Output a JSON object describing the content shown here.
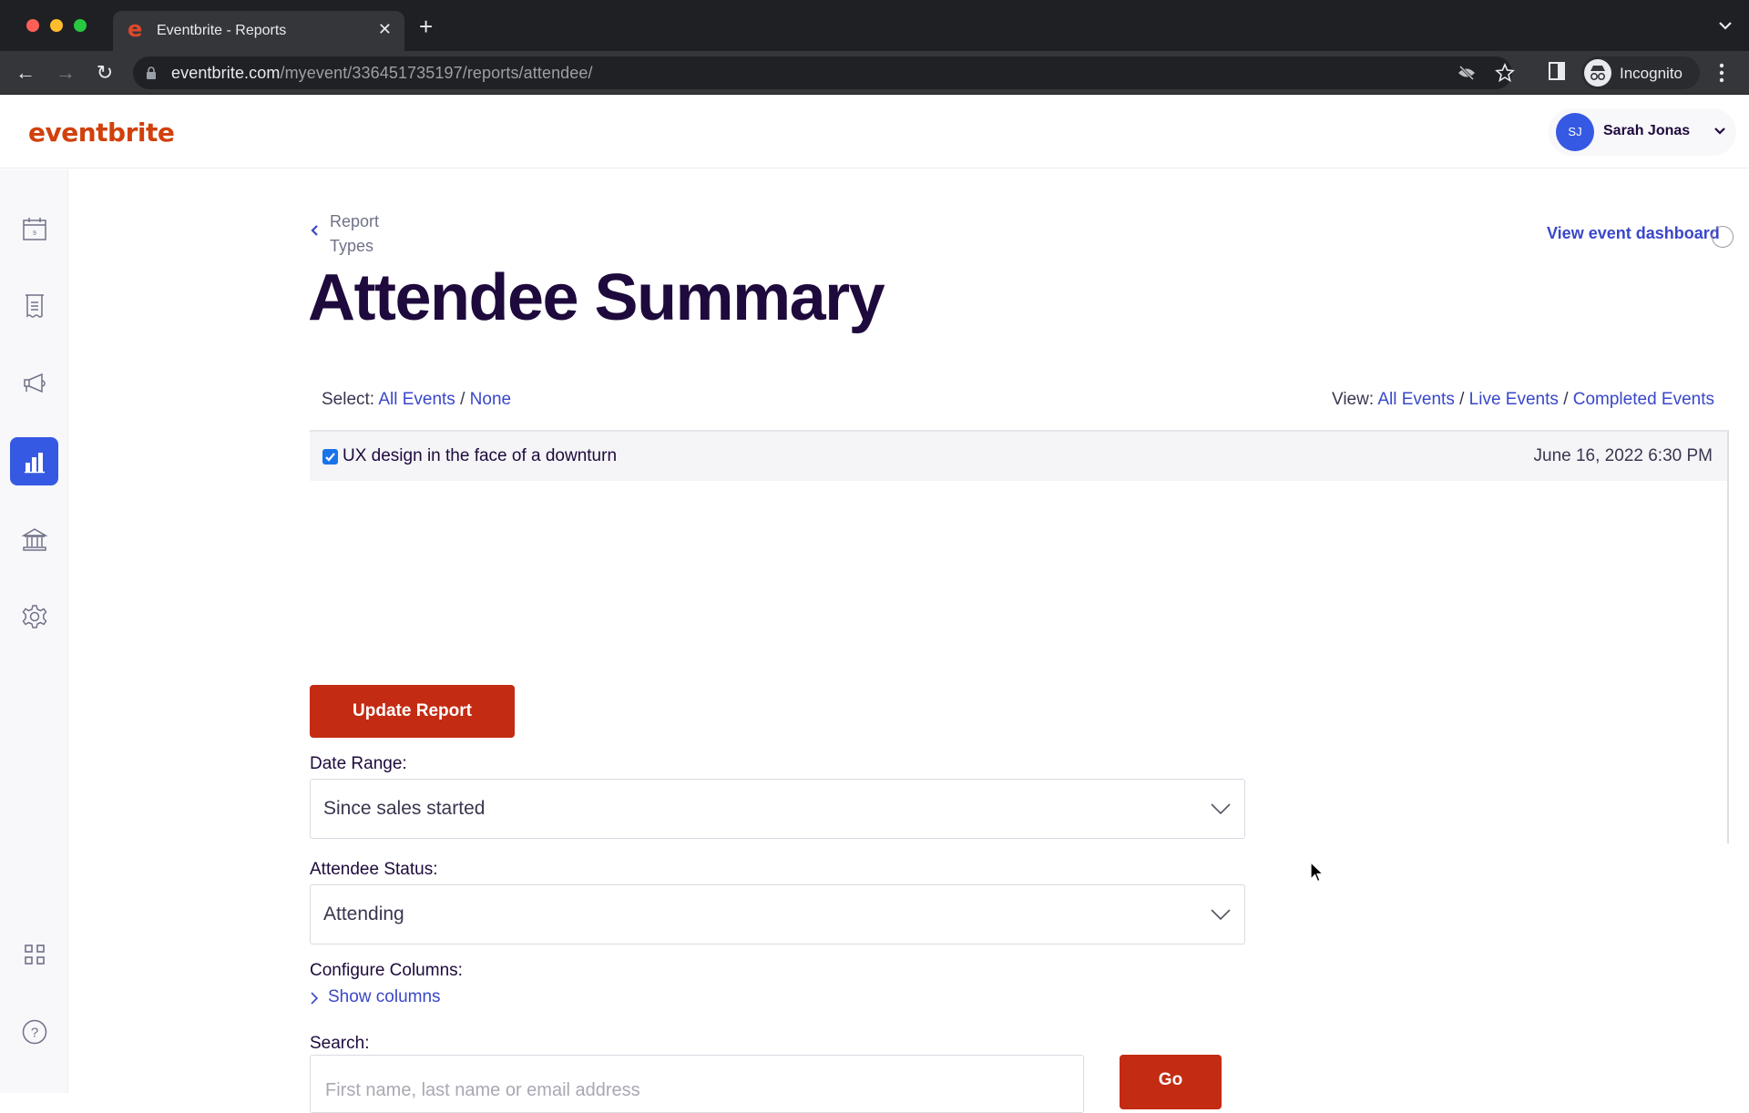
{
  "browser": {
    "tab_title": "Eventbrite - Reports",
    "url_domain": "eventbrite.com",
    "url_path": "/myevent/336451735197/reports/attendee/",
    "profile_label": "Incognito"
  },
  "header": {
    "logo": "eventbrite",
    "user_initials": "SJ",
    "user_name": "Sarah Jonas"
  },
  "sidebar": {
    "items": [
      {
        "name": "events",
        "icon": "calendar-icon",
        "active": false
      },
      {
        "name": "orders",
        "icon": "receipt-icon",
        "active": false
      },
      {
        "name": "marketing",
        "icon": "megaphone-icon",
        "active": false
      },
      {
        "name": "reports",
        "icon": "bar-chart-icon",
        "active": true
      },
      {
        "name": "finance",
        "icon": "bank-icon",
        "active": false
      },
      {
        "name": "settings",
        "icon": "gear-icon",
        "active": false
      },
      {
        "name": "apps",
        "icon": "grid-icon",
        "active": false
      },
      {
        "name": "help",
        "icon": "help-icon",
        "active": false
      }
    ],
    "calendar_day": "9"
  },
  "main": {
    "back_link": "Report Types",
    "title": "Attendee Summary",
    "dashboard_link": "View event dashboard",
    "select": {
      "label": "Select:",
      "all": "All Events",
      "separator": "/",
      "none": "None"
    },
    "view": {
      "label": "View:",
      "all": "All Events",
      "live": "Live Events",
      "completed": "Completed Events",
      "separator": "/"
    },
    "events": [
      {
        "name": "UX design in the face of a downturn",
        "date": "June 16, 2022 6:30 PM",
        "checked": true
      }
    ],
    "update_button": "Update Report",
    "date_range": {
      "label": "Date Range:",
      "value": "Since sales started"
    },
    "attendee_status": {
      "label": "Attendee Status:",
      "value": "Attending"
    },
    "configure_columns": {
      "label": "Configure Columns:",
      "toggle": "Show columns"
    },
    "search": {
      "label": "Search:",
      "placeholder": "First name, last name or email address",
      "value": "",
      "button": "Go"
    }
  },
  "colors": {
    "brand": "#d1410c",
    "primary_button": "#c32b12",
    "link": "#3a47c9",
    "active_nav": "#3659e3",
    "title": "#1e0a3c"
  }
}
